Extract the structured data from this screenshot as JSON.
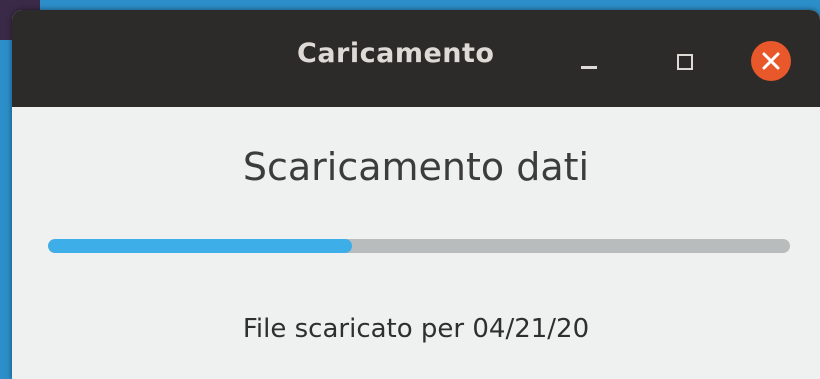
{
  "window": {
    "title": "Caricamento",
    "controls": {
      "minimize": "minimize-icon",
      "maximize": "maximize-icon",
      "close": "close-icon"
    }
  },
  "content": {
    "heading": "Scaricamento dati",
    "progress": {
      "fraction": 0.41
    },
    "status": "File scaricato per 04/21/20"
  },
  "colors": {
    "titlebar": "#2d2b29",
    "window_bg": "#eff0f0",
    "accent": "#3daee8",
    "close_button": "#e9582b",
    "desktop": "#2c8fca"
  }
}
